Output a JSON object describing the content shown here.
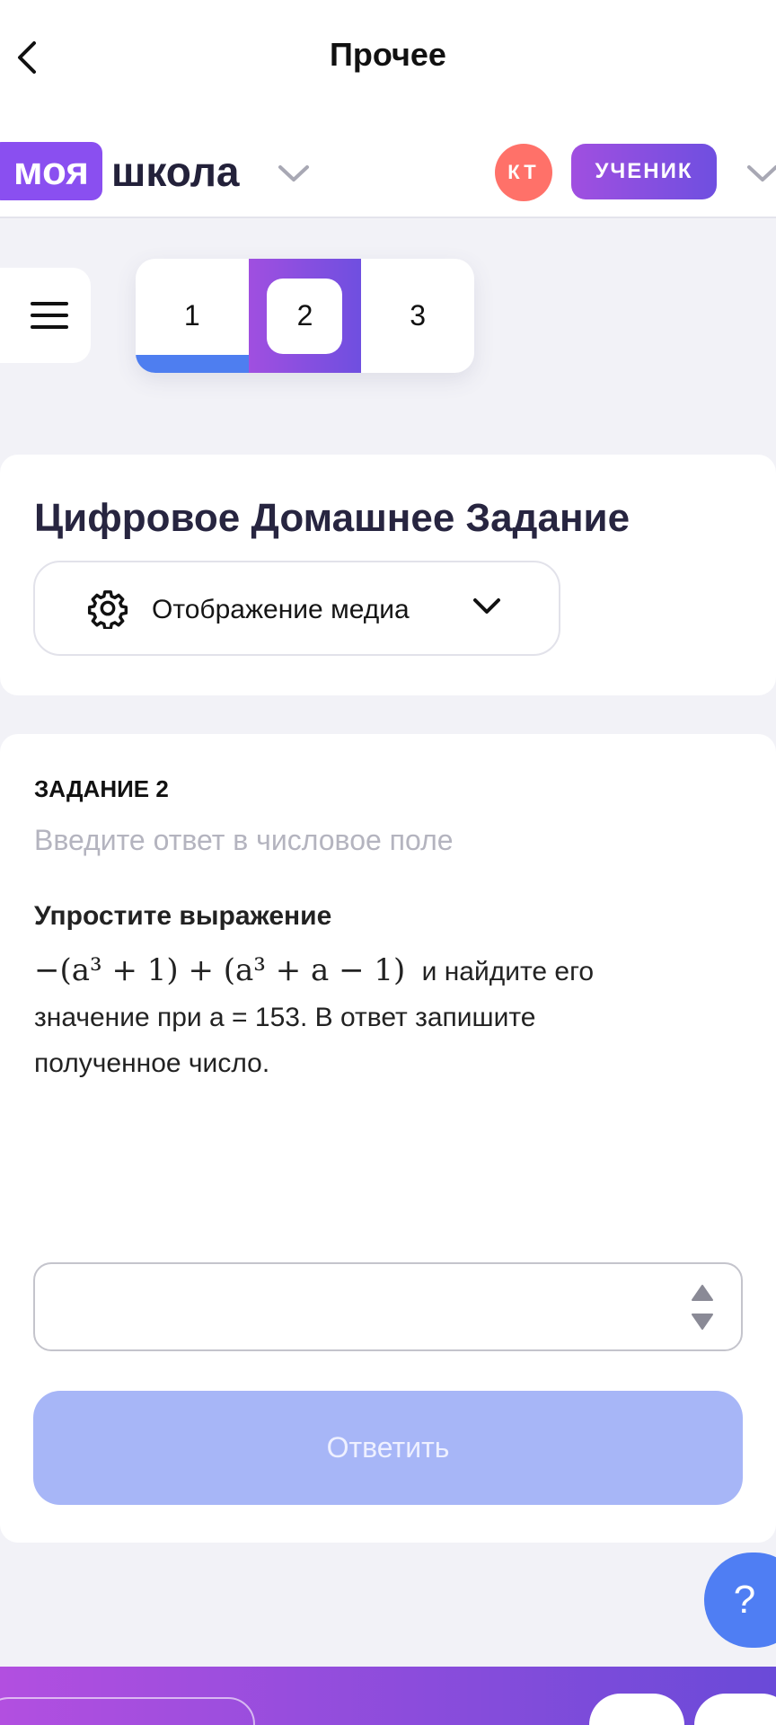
{
  "nav": {
    "title": "Прочее"
  },
  "header": {
    "logo_box": "моя",
    "logo_text": "школа",
    "avatar_initials": "КТ",
    "role": "УЧЕНИК"
  },
  "pager": {
    "pages": [
      "1",
      "2",
      "3"
    ],
    "current": "2"
  },
  "homework": {
    "title": "Цифровое Домашнее Задание",
    "media_button": "Отображение медиа"
  },
  "task": {
    "label": "ЗАДАНИЕ 2",
    "hint": "Введите ответ в числовое поле",
    "question_title": "Упростите выражение",
    "formula": "−(a³ + 1) + (a³ + a − 1)",
    "question_text_1": "и найдите его",
    "question_text_2": "значение при a = 153. В ответ запишите",
    "question_text_3": "полученное число.",
    "answer_value": "",
    "submit_label": "Ответить"
  },
  "help": {
    "label": "?"
  },
  "colors": {
    "accent": "#8a4ff0",
    "blue": "#4e7ef0",
    "avatar": "#ff7169",
    "submit_disabled": "#a7b6f7"
  }
}
